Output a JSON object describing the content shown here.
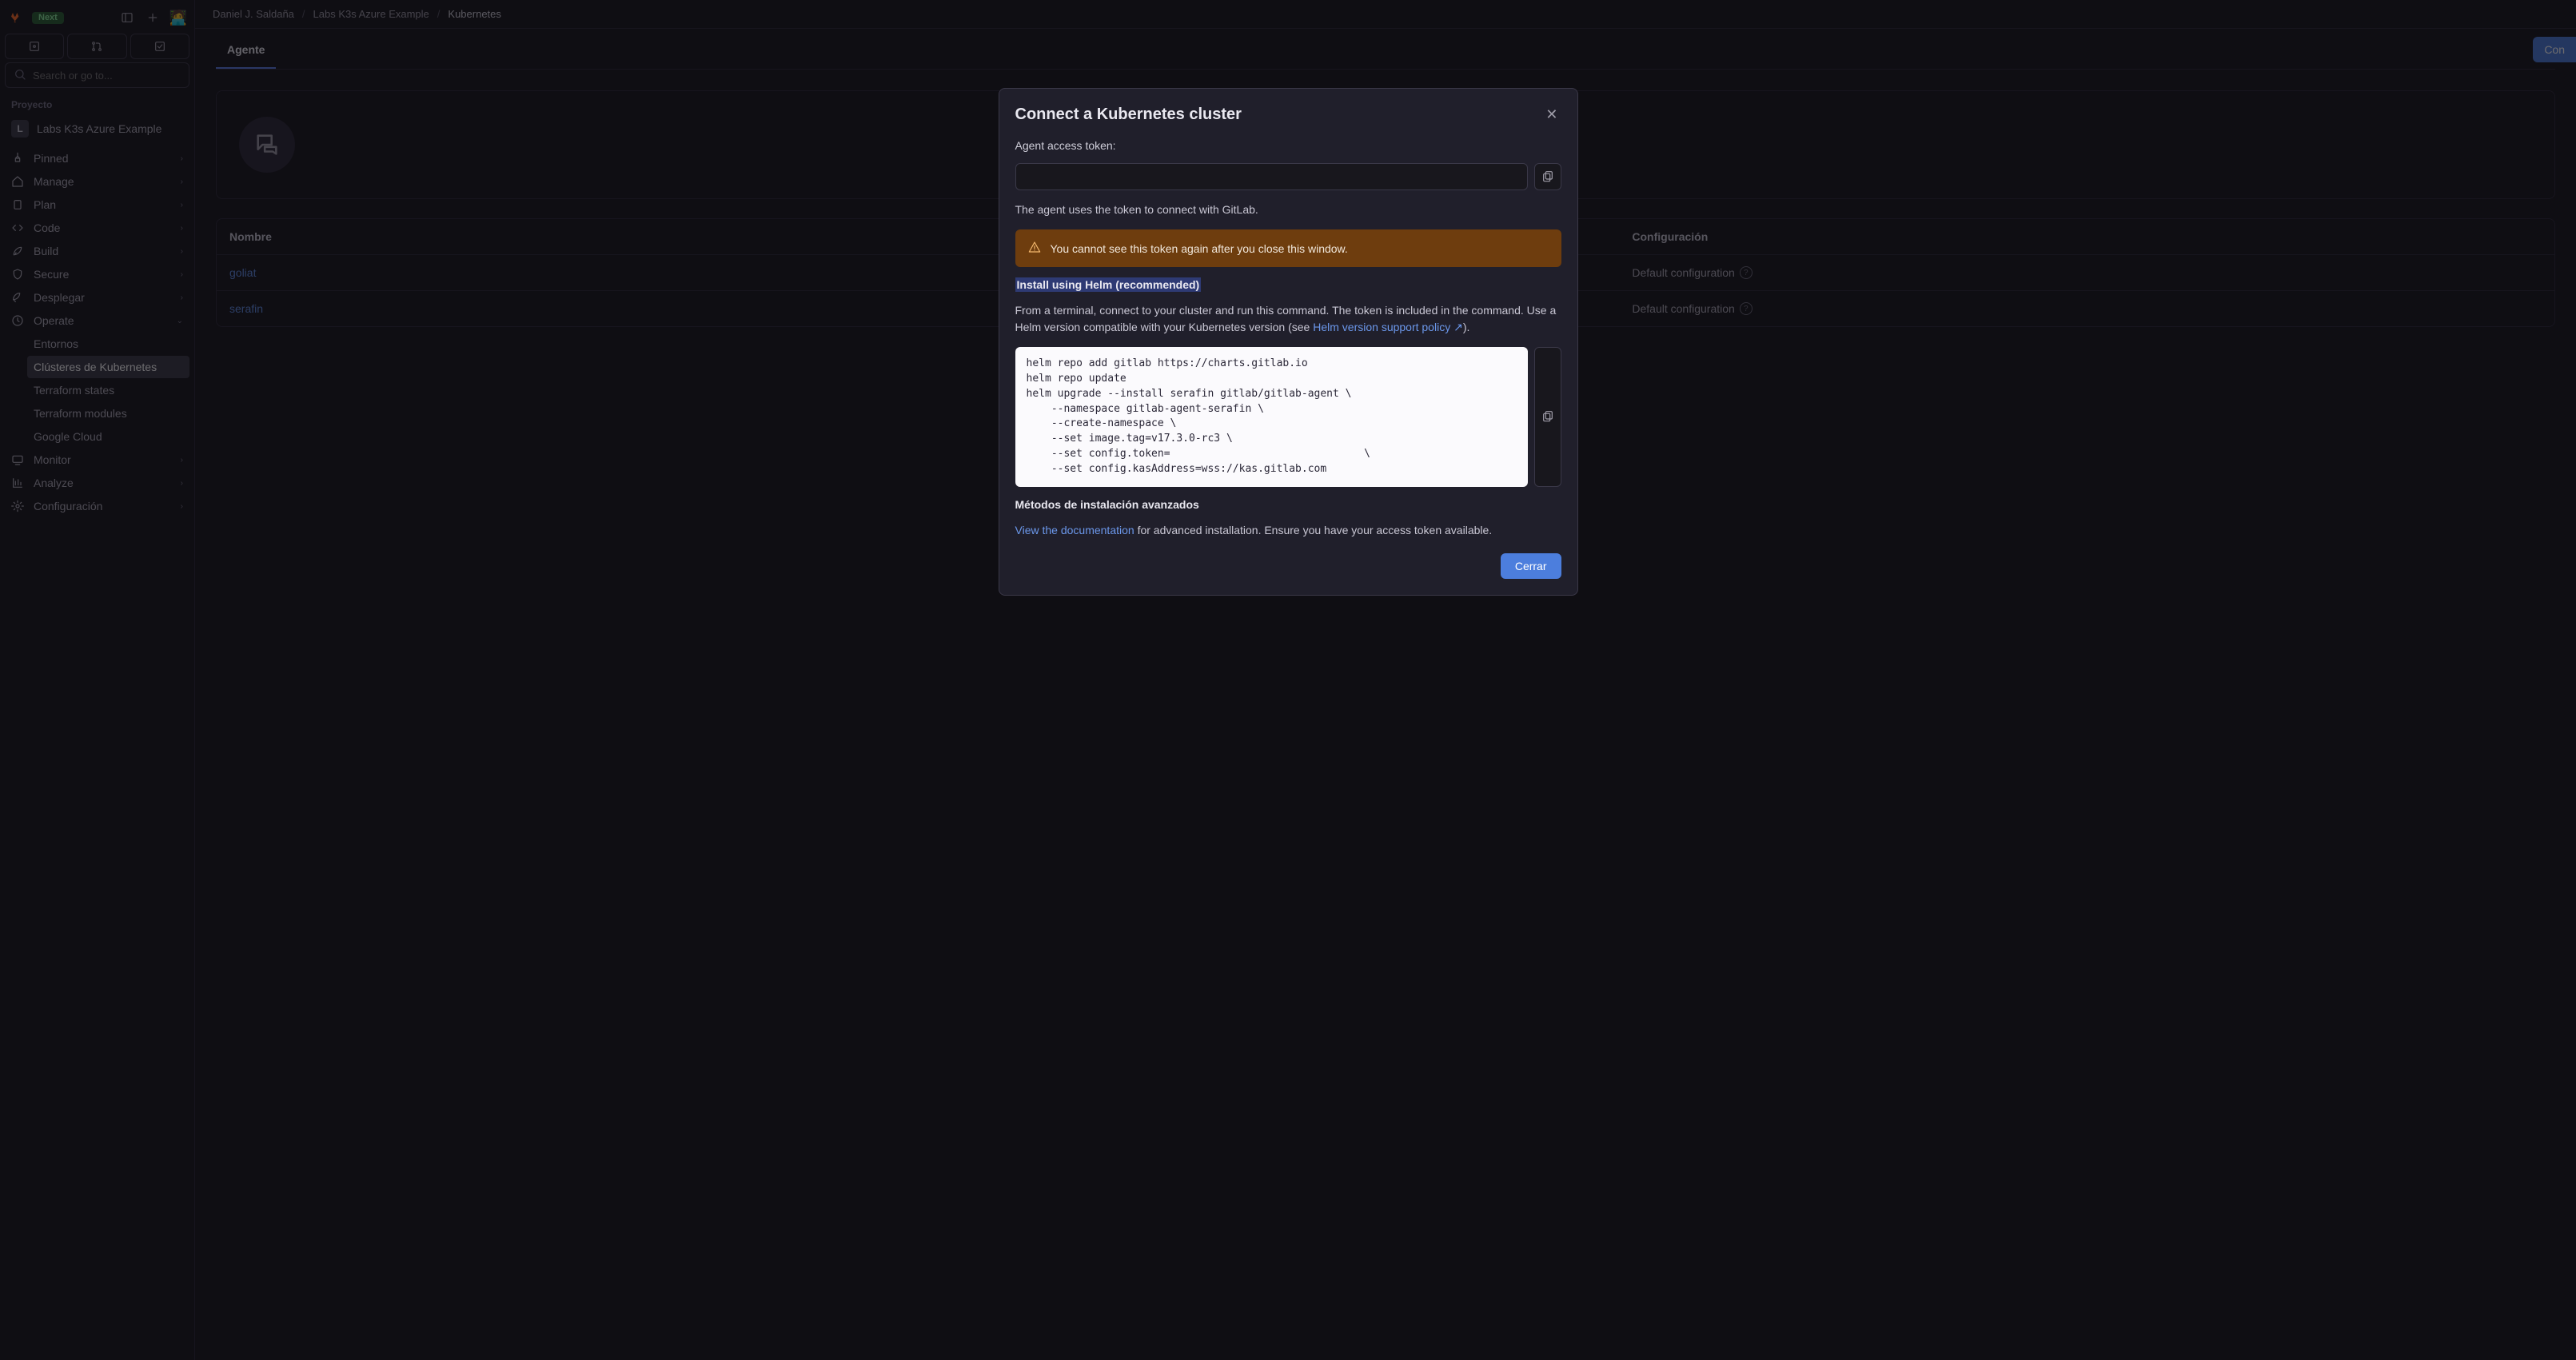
{
  "topbar": {
    "next_badge": "Next"
  },
  "search": {
    "placeholder": "Search or go to..."
  },
  "sidebar": {
    "project_section_label": "Proyecto",
    "project_avatar_letter": "L",
    "project_name": "Labs K3s Azure Example",
    "items": [
      {
        "label": "Pinned"
      },
      {
        "label": "Manage"
      },
      {
        "label": "Plan"
      },
      {
        "label": "Code"
      },
      {
        "label": "Build"
      },
      {
        "label": "Secure"
      },
      {
        "label": "Desplegar"
      },
      {
        "label": "Operate"
      },
      {
        "label": "Monitor"
      },
      {
        "label": "Analyze"
      },
      {
        "label": "Configuración"
      }
    ],
    "operate_children": [
      {
        "label": "Entornos"
      },
      {
        "label": "Clústeres de Kubernetes"
      },
      {
        "label": "Terraform states"
      },
      {
        "label": "Terraform modules"
      },
      {
        "label": "Google Cloud"
      }
    ]
  },
  "breadcrumbs": {
    "a": "Daniel J. Saldaña",
    "b": "Labs K3s Azure Example",
    "c": "Kubernetes"
  },
  "tabs": {
    "agent": "Agente"
  },
  "right_action_prefix": "Con",
  "table": {
    "headers": {
      "name": "Nombre",
      "config": "Configuración"
    },
    "rows": [
      {
        "name": "goliat",
        "config": "Default configuration"
      },
      {
        "name": "serafin",
        "config": "Default configuration"
      }
    ]
  },
  "modal": {
    "title": "Connect a Kubernetes cluster",
    "token_label": "Agent access token:",
    "token_value": "",
    "uses_text": "The agent uses the token to connect with GitLab.",
    "warn_text": "You cannot see this token again after you close this window.",
    "install_heading": "Install using Helm (recommended)",
    "from_terminal_pre": "From a terminal, connect to your cluster and run this command. The token is included in the command. Use a Helm version compatible with your Kubernetes version (see ",
    "helm_policy_link": "Helm version support policy",
    "from_terminal_post": ").",
    "code": "helm repo add gitlab https://charts.gitlab.io\nhelm repo update\nhelm upgrade --install serafin gitlab/gitlab-agent \\\n    --namespace gitlab-agent-serafin \\\n    --create-namespace \\\n    --set image.tag=v17.3.0-rc3 \\\n    --set config.token=                               \\\n    --set config.kasAddress=wss://kas.gitlab.com",
    "advanced_heading": "Métodos de instalación avanzados",
    "view_docs_link": "View the documentation",
    "view_docs_rest": " for advanced installation. Ensure you have your access token available.",
    "close_label": "Cerrar"
  }
}
